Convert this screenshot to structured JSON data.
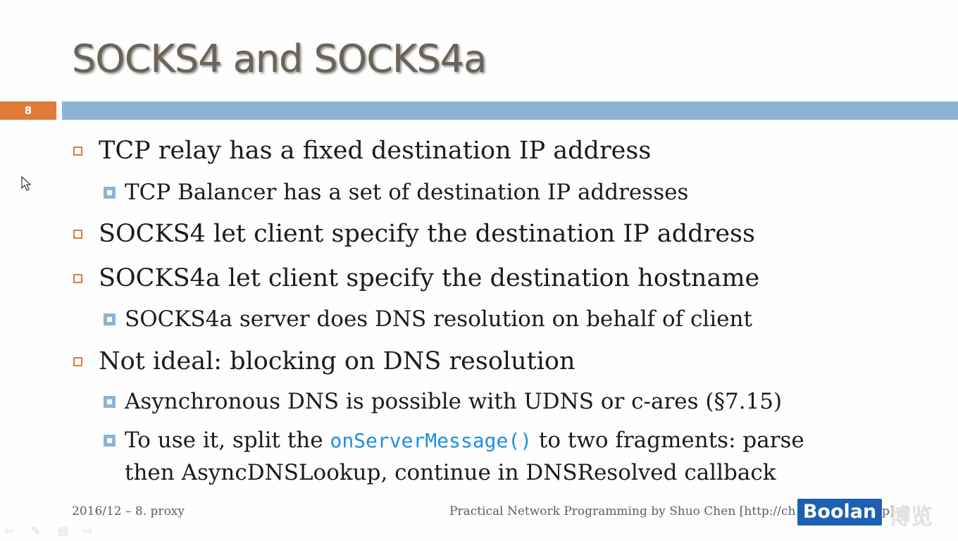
{
  "slide": {
    "title": "SOCKS4 and SOCKS4a",
    "number": "8",
    "bullets": [
      {
        "level": 1,
        "text": "TCP relay has a fixed destination IP address"
      },
      {
        "level": 2,
        "text": "TCP Balancer has a set of destination IP addresses"
      },
      {
        "level": 1,
        "text": "SOCKS4 let client specify the destination IP address"
      },
      {
        "level": 1,
        "text": "SOCKS4a let client specify the destination hostname"
      },
      {
        "level": 2,
        "text": "SOCKS4a server does DNS resolution on behalf of client"
      },
      {
        "level": 1,
        "text": "Not ideal: blocking on DNS resolution"
      },
      {
        "level": 2,
        "text": "Asynchronous DNS is possible with UDNS or c-ares (§7.15)"
      },
      {
        "level": 2,
        "text_before": "To use it, split the ",
        "code": "onServerMessage()",
        "text_after": " to two fragments: parse",
        "text_line2": "then AsyncDNSLookup, continue in DNSResolved callback"
      }
    ],
    "footer_left": "2016/12 – 8. proxy",
    "footer_right": "Practical Network Programming by Shuo Chen [http://ch",
    "footer_right_tail": "p]"
  },
  "watermark": {
    "brand": "Boolan",
    "brand_cn": "博览"
  },
  "colors": {
    "accent_orange": "#e07b39",
    "accent_blue": "#8db3d4",
    "code_blue": "#1e8fe0",
    "logo_blue": "#1d5fb3"
  },
  "icons": {
    "nav": [
      "nav-prev-icon",
      "pen-icon",
      "menu-icon",
      "nav-next-icon"
    ],
    "cursor": "mouse-pointer-icon"
  }
}
